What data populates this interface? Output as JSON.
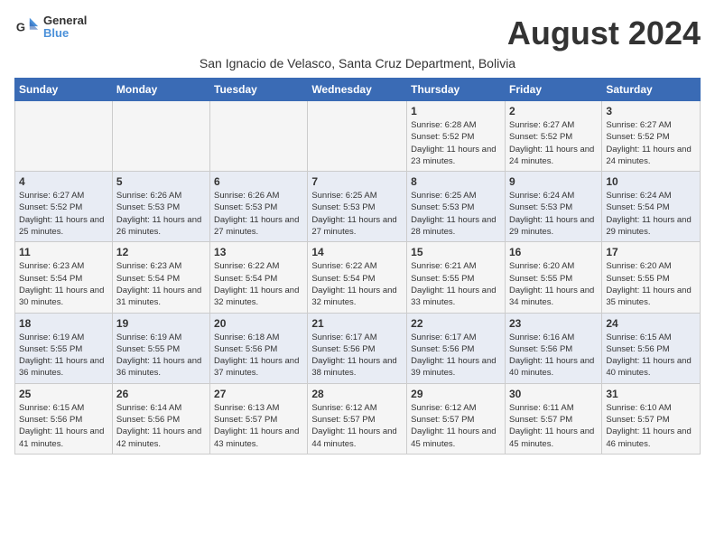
{
  "header": {
    "logo_line1": "General",
    "logo_line2": "Blue",
    "month_title": "August 2024",
    "subtitle": "San Ignacio de Velasco, Santa Cruz Department, Bolivia"
  },
  "weekdays": [
    "Sunday",
    "Monday",
    "Tuesday",
    "Wednesday",
    "Thursday",
    "Friday",
    "Saturday"
  ],
  "weeks": [
    [
      {
        "day": "",
        "info": ""
      },
      {
        "day": "",
        "info": ""
      },
      {
        "day": "",
        "info": ""
      },
      {
        "day": "",
        "info": ""
      },
      {
        "day": "1",
        "info": "Sunrise: 6:28 AM\nSunset: 5:52 PM\nDaylight: 11 hours and 23 minutes."
      },
      {
        "day": "2",
        "info": "Sunrise: 6:27 AM\nSunset: 5:52 PM\nDaylight: 11 hours and 24 minutes."
      },
      {
        "day": "3",
        "info": "Sunrise: 6:27 AM\nSunset: 5:52 PM\nDaylight: 11 hours and 24 minutes."
      }
    ],
    [
      {
        "day": "4",
        "info": "Sunrise: 6:27 AM\nSunset: 5:52 PM\nDaylight: 11 hours and 25 minutes."
      },
      {
        "day": "5",
        "info": "Sunrise: 6:26 AM\nSunset: 5:53 PM\nDaylight: 11 hours and 26 minutes."
      },
      {
        "day": "6",
        "info": "Sunrise: 6:26 AM\nSunset: 5:53 PM\nDaylight: 11 hours and 27 minutes."
      },
      {
        "day": "7",
        "info": "Sunrise: 6:25 AM\nSunset: 5:53 PM\nDaylight: 11 hours and 27 minutes."
      },
      {
        "day": "8",
        "info": "Sunrise: 6:25 AM\nSunset: 5:53 PM\nDaylight: 11 hours and 28 minutes."
      },
      {
        "day": "9",
        "info": "Sunrise: 6:24 AM\nSunset: 5:53 PM\nDaylight: 11 hours and 29 minutes."
      },
      {
        "day": "10",
        "info": "Sunrise: 6:24 AM\nSunset: 5:54 PM\nDaylight: 11 hours and 29 minutes."
      }
    ],
    [
      {
        "day": "11",
        "info": "Sunrise: 6:23 AM\nSunset: 5:54 PM\nDaylight: 11 hours and 30 minutes."
      },
      {
        "day": "12",
        "info": "Sunrise: 6:23 AM\nSunset: 5:54 PM\nDaylight: 11 hours and 31 minutes."
      },
      {
        "day": "13",
        "info": "Sunrise: 6:22 AM\nSunset: 5:54 PM\nDaylight: 11 hours and 32 minutes."
      },
      {
        "day": "14",
        "info": "Sunrise: 6:22 AM\nSunset: 5:54 PM\nDaylight: 11 hours and 32 minutes."
      },
      {
        "day": "15",
        "info": "Sunrise: 6:21 AM\nSunset: 5:55 PM\nDaylight: 11 hours and 33 minutes."
      },
      {
        "day": "16",
        "info": "Sunrise: 6:20 AM\nSunset: 5:55 PM\nDaylight: 11 hours and 34 minutes."
      },
      {
        "day": "17",
        "info": "Sunrise: 6:20 AM\nSunset: 5:55 PM\nDaylight: 11 hours and 35 minutes."
      }
    ],
    [
      {
        "day": "18",
        "info": "Sunrise: 6:19 AM\nSunset: 5:55 PM\nDaylight: 11 hours and 36 minutes."
      },
      {
        "day": "19",
        "info": "Sunrise: 6:19 AM\nSunset: 5:55 PM\nDaylight: 11 hours and 36 minutes."
      },
      {
        "day": "20",
        "info": "Sunrise: 6:18 AM\nSunset: 5:56 PM\nDaylight: 11 hours and 37 minutes."
      },
      {
        "day": "21",
        "info": "Sunrise: 6:17 AM\nSunset: 5:56 PM\nDaylight: 11 hours and 38 minutes."
      },
      {
        "day": "22",
        "info": "Sunrise: 6:17 AM\nSunset: 5:56 PM\nDaylight: 11 hours and 39 minutes."
      },
      {
        "day": "23",
        "info": "Sunrise: 6:16 AM\nSunset: 5:56 PM\nDaylight: 11 hours and 40 minutes."
      },
      {
        "day": "24",
        "info": "Sunrise: 6:15 AM\nSunset: 5:56 PM\nDaylight: 11 hours and 40 minutes."
      }
    ],
    [
      {
        "day": "25",
        "info": "Sunrise: 6:15 AM\nSunset: 5:56 PM\nDaylight: 11 hours and 41 minutes."
      },
      {
        "day": "26",
        "info": "Sunrise: 6:14 AM\nSunset: 5:56 PM\nDaylight: 11 hours and 42 minutes."
      },
      {
        "day": "27",
        "info": "Sunrise: 6:13 AM\nSunset: 5:57 PM\nDaylight: 11 hours and 43 minutes."
      },
      {
        "day": "28",
        "info": "Sunrise: 6:12 AM\nSunset: 5:57 PM\nDaylight: 11 hours and 44 minutes."
      },
      {
        "day": "29",
        "info": "Sunrise: 6:12 AM\nSunset: 5:57 PM\nDaylight: 11 hours and 45 minutes."
      },
      {
        "day": "30",
        "info": "Sunrise: 6:11 AM\nSunset: 5:57 PM\nDaylight: 11 hours and 45 minutes."
      },
      {
        "day": "31",
        "info": "Sunrise: 6:10 AM\nSunset: 5:57 PM\nDaylight: 11 hours and 46 minutes."
      }
    ]
  ]
}
